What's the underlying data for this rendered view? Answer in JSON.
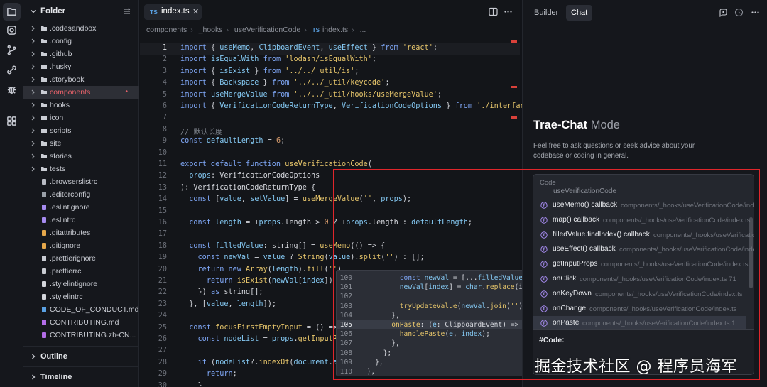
{
  "colors": {
    "accent_red": "#e0262b",
    "selected_file": "#e8626a",
    "keyword": "#7fa7f6",
    "string": "#e6c56b"
  },
  "activity_bar": {
    "icons": [
      "files-icon",
      "search-icon",
      "source-control-icon",
      "extensions-icon",
      "debug-icon",
      "apps-icon"
    ]
  },
  "explorer": {
    "title": "Folder",
    "items": [
      {
        "label": ".codesandbox",
        "type": "folder"
      },
      {
        "label": ".config",
        "type": "folder"
      },
      {
        "label": ".github",
        "type": "folder"
      },
      {
        "label": ".husky",
        "type": "folder"
      },
      {
        "label": ".storybook",
        "type": "folder"
      },
      {
        "label": "components",
        "type": "folder",
        "selected": true,
        "badge": "•"
      },
      {
        "label": "hooks",
        "type": "folder"
      },
      {
        "label": "icon",
        "type": "folder"
      },
      {
        "label": "scripts",
        "type": "folder"
      },
      {
        "label": "site",
        "type": "folder"
      },
      {
        "label": "stories",
        "type": "folder"
      },
      {
        "label": "tests",
        "type": "folder"
      },
      {
        "label": ".browserslistrc",
        "type": "file"
      },
      {
        "label": ".editorconfig",
        "type": "file"
      },
      {
        "label": ".eslintignore",
        "type": "file"
      },
      {
        "label": ".eslintrc",
        "type": "file"
      },
      {
        "label": ".gitattributes",
        "type": "file"
      },
      {
        "label": ".gitignore",
        "type": "file"
      },
      {
        "label": ".prettierignore",
        "type": "file"
      },
      {
        "label": ".prettierrc",
        "type": "file"
      },
      {
        "label": ".stylelintignore",
        "type": "file"
      },
      {
        "label": ".stylelintrc",
        "type": "file"
      },
      {
        "label": "CODE_OF_CONDUCT.md",
        "type": "file"
      },
      {
        "label": "CONTRIBUTING.md",
        "type": "file"
      },
      {
        "label": "CONTRIBUTING.zh-CN...",
        "type": "file"
      }
    ],
    "sections": [
      "Outline",
      "Timeline"
    ]
  },
  "editor": {
    "tab": {
      "badge": "TS",
      "label": "index.ts",
      "close": "✕"
    },
    "breadcrumb": [
      "components",
      "_hooks",
      "useVerificationCode",
      "index.ts",
      "..."
    ],
    "breadcrumb_badge": "TS",
    "lines": [
      {
        "n": "1",
        "html": "<span class='kw'>import</span> { <span class='var'>useMemo</span>, <span class='var'>ClipboardEvent</span>, <span class='var'>useEffect</span> } <span class='kw'>from</span> <span class='str'>'react'</span>;"
      },
      {
        "n": "2",
        "html": "<span class='kw'>import</span> <span class='var'>isEqualWith</span> <span class='kw'>from</span> <span class='str'>'lodash/isEqualWith'</span>;"
      },
      {
        "n": "3",
        "html": "<span class='kw'>import</span> { <span class='var'>isExist</span> } <span class='kw'>from</span> <span class='str'>'../../_util/is'</span>;"
      },
      {
        "n": "4",
        "html": "<span class='kw'>import</span> { <span class='var'>Backspace</span> } <span class='kw'>from</span> <span class='str'>'../../_util/keycode'</span>;"
      },
      {
        "n": "5",
        "html": "<span class='kw'>import</span> <span class='var'>useMergeValue</span> <span class='kw'>from</span> <span class='str'>'../../_util/hooks/useMergeValue'</span>;"
      },
      {
        "n": "6",
        "html": "<span class='kw'>import</span> { <span class='var'>VerificationCodeReturnType</span>, <span class='var'>VerificationCodeOptions</span> } <span class='kw'>from</span> <span class='str'>'./interface'</span>"
      },
      {
        "n": "7",
        "html": ""
      },
      {
        "n": "8",
        "html": "<span class='cm'>// 默认长度</span>"
      },
      {
        "n": "9",
        "html": "<span class='kw'>const</span> <span class='var'>defaultLength</span> = <span class='num'>6</span>;"
      },
      {
        "n": "10",
        "html": ""
      },
      {
        "n": "11",
        "html": "<span class='kw'>export default function</span> <span class='fn'>useVerificationCode</span>("
      },
      {
        "n": "12",
        "html": "  <span class='var'>props</span>: <span class='ty'>VerificationCodeOptions</span>"
      },
      {
        "n": "13",
        "html": "): <span class='ty'>VerificationCodeReturnType</span> {"
      },
      {
        "n": "14",
        "html": "  <span class='kw'>const</span> [<span class='var'>value</span>, <span class='var'>setValue</span>] = <span class='fn'>useMergeValue</span>(<span class='str'>''</span>, <span class='var'>props</span>);"
      },
      {
        "n": "15",
        "html": ""
      },
      {
        "n": "16",
        "html": "  <span class='kw'>const</span> <span class='var'>length</span> = +<span class='var'>props</span>.length &gt; <span class='num'>0</span> ? +<span class='var'>props</span>.length : <span class='var'>defaultLength</span>;"
      },
      {
        "n": "17",
        "html": ""
      },
      {
        "n": "18",
        "html": "  <span class='kw'>const</span> <span class='var'>filledValue</span>: string[] = <span class='fn'>useMemo</span>(() =&gt; {"
      },
      {
        "n": "19",
        "html": "    <span class='kw'>const</span> <span class='var'>newVal</span> = <span class='var'>value</span> ? <span class='fn'>String</span>(<span class='var'>value</span>).<span class='fn'>split</span>(<span class='str'>''</span>) : [];"
      },
      {
        "n": "20",
        "html": "    <span class='kw'>return new</span> <span class='fn'>Array</span>(<span class='var'>length</span>).<span class='fn'>fill</span>(<span class='str'>''</span>)."
      },
      {
        "n": "21",
        "html": "      <span class='kw'>return</span> <span class='fn'>isExist</span>(<span class='var'>newVal</span>[<span class='var'>index</span>]) ?"
      },
      {
        "n": "22",
        "html": "    }) <span class='kw'>as</span> string[];"
      },
      {
        "n": "23",
        "html": "  }, [<span class='var'>value</span>, <span class='var'>length</span>]);"
      },
      {
        "n": "24",
        "html": ""
      },
      {
        "n": "25",
        "html": "  <span class='kw'>const</span> <span class='fn'>focusFirstEmptyInput</span> = () =&gt;"
      },
      {
        "n": "26",
        "html": "    <span class='kw'>const</span> <span class='var'>nodeList</span> = <span class='var'>props</span>.<span class='fn'>getInputRe</span>"
      },
      {
        "n": "27",
        "html": ""
      },
      {
        "n": "28",
        "html": "    <span class='kw'>if</span> (<span class='var'>nodeList</span>?.<span class='fn'>indexOf</span>(<span class='var'>document</span>.<span class='var'>act</span>"
      },
      {
        "n": "29",
        "html": "      <span class='kw'>return</span>;"
      },
      {
        "n": "30",
        "html": "    }"
      }
    ],
    "peek": [
      {
        "n": "100",
        "html": "          <span class='kw'>const</span> <span class='var'>newVal</span> = [...<span class='var'>filledValue</span>];"
      },
      {
        "n": "101",
        "html": "          <span class='var'>newVal</span>[<span class='var'>index</span>] = <span class='var'>char</span>.<span class='fn'>replace</span>(inde"
      },
      {
        "n": "102",
        "html": ""
      },
      {
        "n": "103",
        "html": "          <span class='fn'>tryUpdateValue</span>(<span class='var'>newVal</span>.<span class='fn'>join</span>(<span class='str'>''</span>));"
      },
      {
        "n": "104",
        "html": "        },"
      },
      {
        "n": "105",
        "html": "        <span class='fn'>onPaste</span>: (<span class='var'>e</span>: <span class='ty'>ClipboardEvent</span>) =&gt; {"
      },
      {
        "n": "106",
        "html": "          <span class='fn'>handlePaste</span>(<span class='var'>e</span>, <span class='var'>index</span>);"
      },
      {
        "n": "107",
        "html": "        },"
      },
      {
        "n": "108",
        "html": "      };"
      },
      {
        "n": "109",
        "html": "    },"
      },
      {
        "n": "110",
        "html": "  ),"
      }
    ]
  },
  "chat": {
    "tabs": [
      "Builder",
      "Chat"
    ],
    "active_tab": "Chat",
    "hero_title": "Trae-Chat",
    "hero_mode": "Mode",
    "hero_desc": "Feel free to ask questions or seek advice about your codebase or coding in general.",
    "popup": {
      "header": "Code",
      "partial_item": "useVerificationCode",
      "items": [
        {
          "name": "useMemo() callback",
          "path": "components/_hooks/useVerificationCode/index.ts"
        },
        {
          "name": "map() callback",
          "path": "components/_hooks/useVerificationCode/index.ts"
        },
        {
          "name": "filledValue.findIndex() callback",
          "path": "components/_hooks/useVerificationCode/index.ts"
        },
        {
          "name": "useEffect() callback",
          "path": "components/_hooks/useVerificationCode/index.ts"
        },
        {
          "name": "getInputProps",
          "path": "components/_hooks/useVerificationCode/index.ts"
        },
        {
          "name": "onClick",
          "path": "components/_hooks/useVerificationCode/index.ts 71"
        },
        {
          "name": "onKeyDown",
          "path": "components/_hooks/useVerificationCode/index.ts"
        },
        {
          "name": "onChange",
          "path": "components/_hooks/useVerificationCode/index.ts"
        },
        {
          "name": "onPaste",
          "path": "components/_hooks/useVerificationCode/index.ts 1"
        }
      ],
      "selected_index": 8
    },
    "input_value": "#Code:"
  },
  "watermark": "掘金技术社区 @ 程序员海军"
}
